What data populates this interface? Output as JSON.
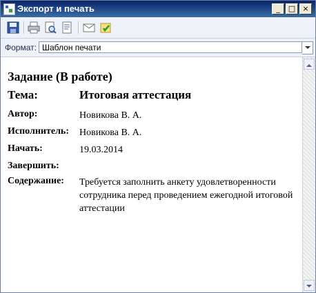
{
  "window": {
    "title": "Экспорт и печать",
    "buttons": [
      "_",
      "□",
      "×"
    ]
  },
  "toolbar": {
    "buttons": [
      "save-icon",
      "print-icon",
      "print-preview-icon",
      "page-setup-icon",
      "email-icon",
      "export-icon"
    ]
  },
  "format": {
    "label": "Формат:",
    "selected": "Шаблон печати"
  },
  "document": {
    "heading": "Задание (В работе)",
    "theme_label": "Тема:",
    "theme_value": "Итоговая аттестация",
    "fields": [
      {
        "label": "Автор:",
        "value": "Новикова В. А."
      },
      {
        "label": "Исполнитель:",
        "value": "Новикова В. А."
      },
      {
        "label": "Начать:",
        "value": "19.03.2014"
      },
      {
        "label": "Завершить:",
        "value": ""
      },
      {
        "label": "Содержание:",
        "value": "Требуется заполнить анкету удовлетворенности сотрудника перед проведением ежегодной итоговой аттестации"
      }
    ]
  },
  "colors": {
    "titlebar_start": "#0a246a",
    "titlebar_end": "#3a6ea5",
    "toolbar_bg": "#eef1f7"
  }
}
